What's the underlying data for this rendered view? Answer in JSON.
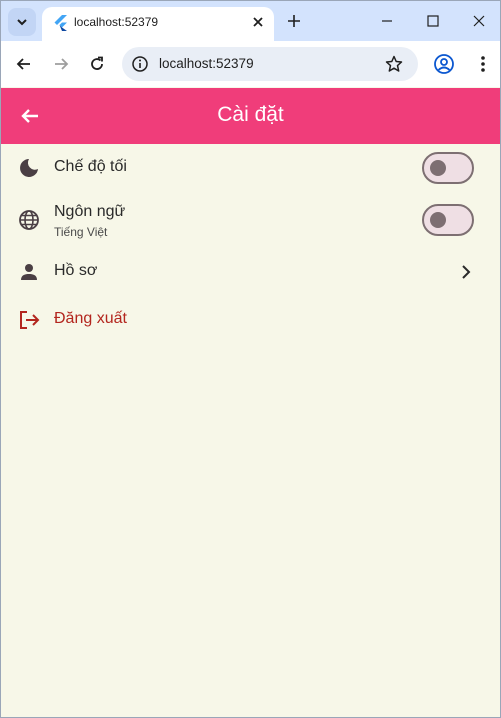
{
  "browser": {
    "tab_title": "localhost:52379",
    "url": "localhost:52379"
  },
  "app": {
    "title": "Cài đặt",
    "accent": "#f03d7a",
    "background": "#f7f7e8"
  },
  "settings": {
    "dark_mode": {
      "label": "Chế độ tối",
      "enabled": false,
      "icon": "moon-icon"
    },
    "language": {
      "label": "Ngôn ngữ",
      "value": "Tiếng Việt",
      "enabled": false,
      "icon": "globe-icon"
    },
    "profile": {
      "label": "Hồ sơ",
      "icon": "person-icon"
    },
    "logout": {
      "label": "Đăng xuất",
      "icon": "logout-icon",
      "color": "#b3261e"
    }
  }
}
